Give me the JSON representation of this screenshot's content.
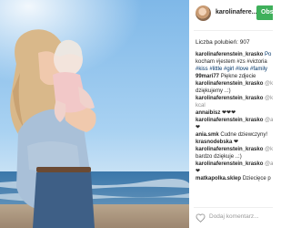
{
  "post": {
    "author": "karolinafere...",
    "follow_label": "Obs",
    "likes_label": "Liczba polubień: 907"
  },
  "comments": [
    {
      "user": "karolinaferenstein_krasko",
      "text": " Po"
    },
    {
      "user": "",
      "text": "kocham #jestem #zs #victoria"
    },
    {
      "user": "",
      "text": "#kiss #little #girl #love #family"
    },
    {
      "user": "99mari77",
      "text": " Piękne zdjecie"
    },
    {
      "user": "karolinaferenstein_krasko",
      "text": " @k"
    },
    {
      "user": "",
      "text": "dziękujemy ..:)"
    },
    {
      "user": "karolinaferenstein_krasko",
      "text": " @k"
    },
    {
      "user": "",
      "text": "kcal"
    },
    {
      "user": "annaibisz",
      "text": " ❤❤❤"
    },
    {
      "user": "karolinaferenstein_krasko",
      "text": " @a"
    },
    {
      "user": "",
      "text": "❤"
    },
    {
      "user": "ania.smk",
      "text": " Cudne dziewczyny!"
    },
    {
      "user": "krasnodebska",
      "text": " ❤"
    },
    {
      "user": "karolinaferenstein_krasko",
      "text": " @k"
    },
    {
      "user": "",
      "text": "bardzo dziękuje ..:)"
    },
    {
      "user": "karolinaferenstein_krasko",
      "text": " @a"
    },
    {
      "user": "",
      "text": "❤"
    },
    {
      "user": "matkapolka.sklep",
      "text": " Dziecięce p"
    }
  ],
  "footer": {
    "comment_placeholder": "Dodaj komentarz..."
  },
  "colors": {
    "follow": "#3fb05b",
    "sky": "#8fc3ec",
    "sea": "#2f6fa3"
  }
}
